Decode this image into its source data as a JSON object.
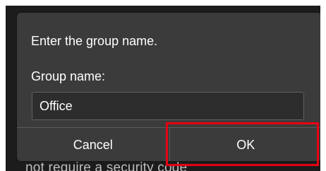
{
  "background": {
    "partial_text": "not require a security code"
  },
  "dialog": {
    "prompt": "Enter the group name.",
    "field_label": "Group name:",
    "input_value": "Office",
    "cancel_label": "Cancel",
    "ok_label": "OK"
  },
  "colors": {
    "dialog_bg": "#3b3b3b",
    "screen_bg": "#1c1c1c",
    "highlight": "#e60012"
  }
}
